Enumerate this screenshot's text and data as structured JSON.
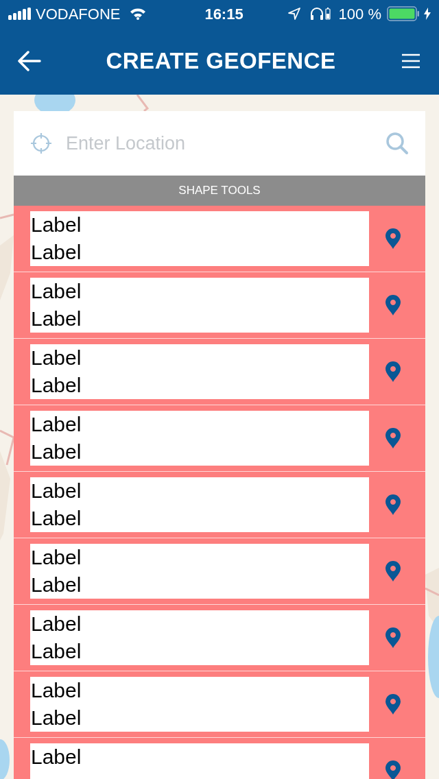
{
  "status_bar": {
    "carrier": "VODAFONE",
    "time": "16:15",
    "battery": "100 %"
  },
  "header": {
    "title": "CREATE GEOFENCE"
  },
  "search": {
    "placeholder": "Enter Location"
  },
  "section_title": "SHAPE TOOLS",
  "rows": [
    {
      "labels": [
        "Label",
        "Label"
      ]
    },
    {
      "labels": [
        "Label",
        "Label"
      ]
    },
    {
      "labels": [
        "Label",
        "Label"
      ]
    },
    {
      "labels": [
        "Label",
        "Label"
      ]
    },
    {
      "labels": [
        "Label",
        "Label"
      ]
    },
    {
      "labels": [
        "Label",
        "Label"
      ]
    },
    {
      "labels": [
        "Label",
        "Label"
      ]
    },
    {
      "labels": [
        "Label",
        "Label"
      ]
    },
    {
      "labels": [
        "Label"
      ]
    }
  ]
}
